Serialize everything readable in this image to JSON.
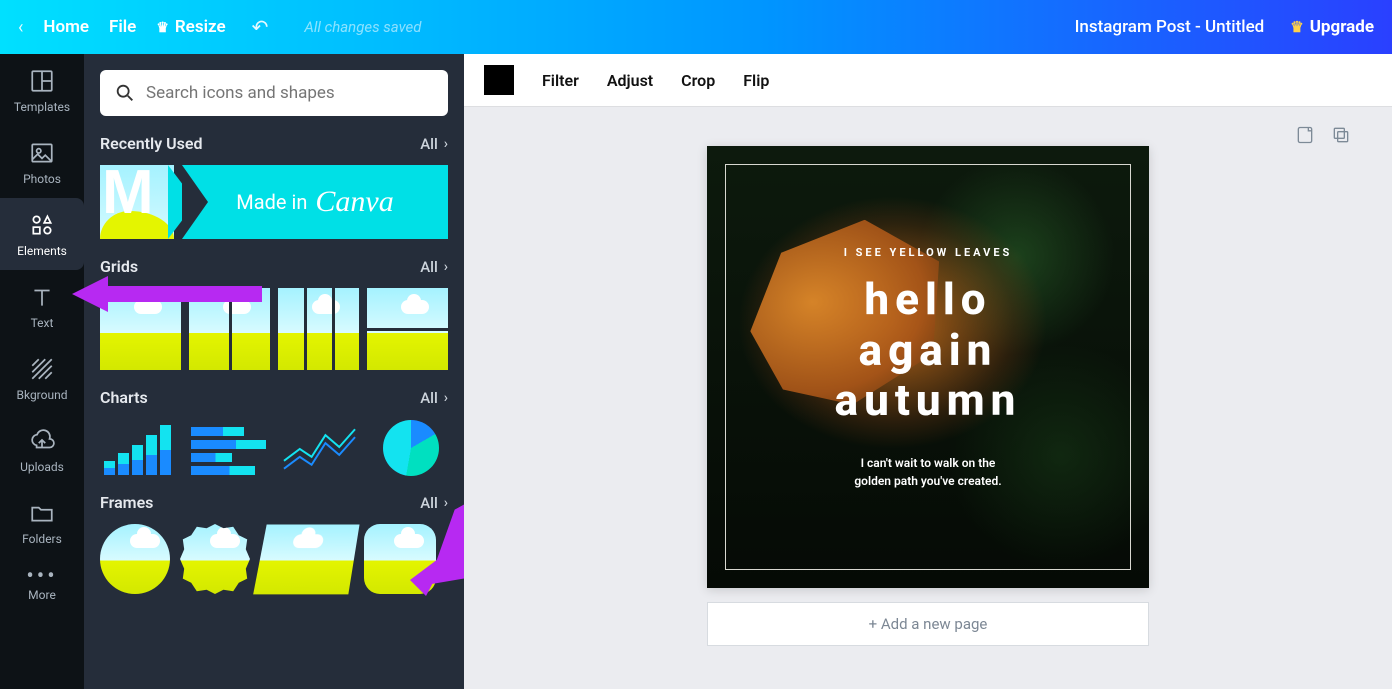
{
  "topbar": {
    "home": "Home",
    "file": "File",
    "resize": "Resize",
    "saved_msg": "All changes saved",
    "doc_title": "Instagram Post - Untitled",
    "upgrade": "Upgrade"
  },
  "rail": {
    "templates": "Templates",
    "photos": "Photos",
    "elements": "Elements",
    "text": "Text",
    "bkground": "Bkground",
    "uploads": "Uploads",
    "folders": "Folders",
    "more": "More"
  },
  "panel": {
    "search_placeholder": "Search icons and shapes",
    "all_label": "All",
    "sections": {
      "recently_used": "Recently Used",
      "grids": "Grids",
      "charts": "Charts",
      "frames": "Frames"
    },
    "recent": {
      "made_in": "Made in",
      "brand": "Canva"
    }
  },
  "canvas_toolbar": {
    "filter": "Filter",
    "adjust": "Adjust",
    "crop": "Crop",
    "flip": "Flip"
  },
  "design": {
    "kicker": "I SEE YELLOW LEAVES",
    "hero_l1": "hello",
    "hero_l2": "again",
    "hero_l3": "autumn",
    "sub_l1": "I can't wait to walk on the",
    "sub_l2": "golden path you've created."
  },
  "add_page": "+ Add a new page"
}
